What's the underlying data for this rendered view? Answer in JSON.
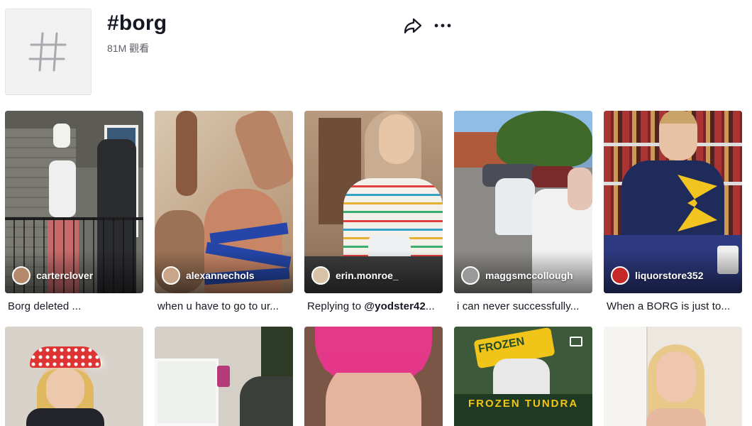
{
  "header": {
    "tag_icon": "hashtag-icon",
    "title": "#borg",
    "views": "81M 觀看",
    "share_icon": "share-icon",
    "more_icon": "more-dots-icon"
  },
  "videos": [
    {
      "username": "carterclover",
      "caption": "Borg deleted ..."
    },
    {
      "username": "alexannechols",
      "caption": "when u have to go to ur..."
    },
    {
      "username": "erin.monroe_",
      "caption_prefix": "Replying to ",
      "caption_mention": "@yodster42",
      "caption_suffix": "..."
    },
    {
      "username": "maggsmccollough",
      "caption": "i can never successfully..."
    },
    {
      "username": "liquorstore352",
      "caption": "When a BORG is just to..."
    }
  ],
  "row2": {
    "frozen_text_top": "FROZEN",
    "frozen_text_bottom": "FROZEN TUNDRA"
  },
  "colors": {
    "text_primary": "#161823",
    "text_secondary": "#5c5e66",
    "thumb_placeholder": "#f1f1f2"
  }
}
